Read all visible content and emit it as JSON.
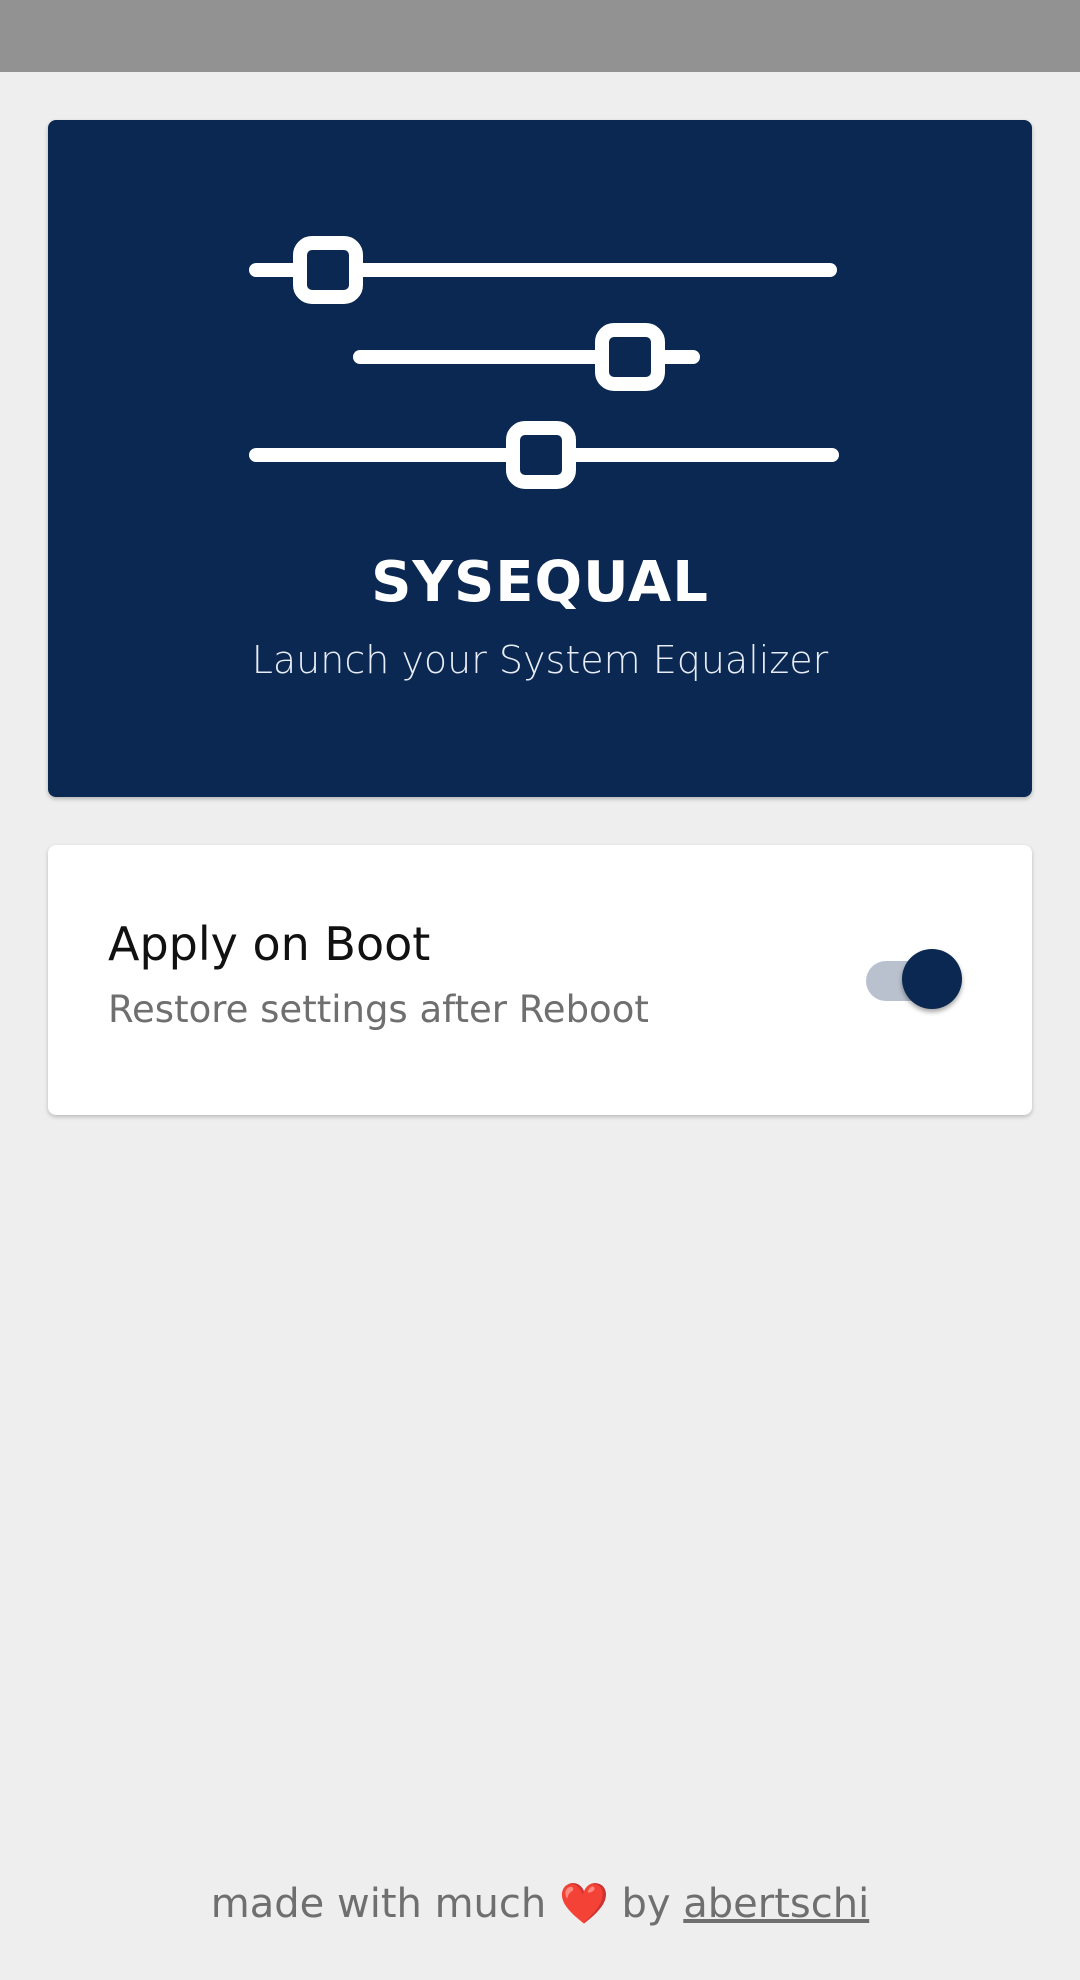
{
  "app": {
    "title": "SYSEQUAL",
    "subtitle": "Launch your System Equalizer",
    "logo_icon": "sliders-icon",
    "brand_color": "#0a2851"
  },
  "settings": {
    "items": [
      {
        "title": "Apply on Boot",
        "description": "Restore settings after Reboot",
        "enabled": true,
        "toggle_icon": "toggle-switch"
      }
    ]
  },
  "footer": {
    "text_before": "made with much",
    "heart": "❤️",
    "text_by": "by",
    "author_link": "abertschi"
  }
}
